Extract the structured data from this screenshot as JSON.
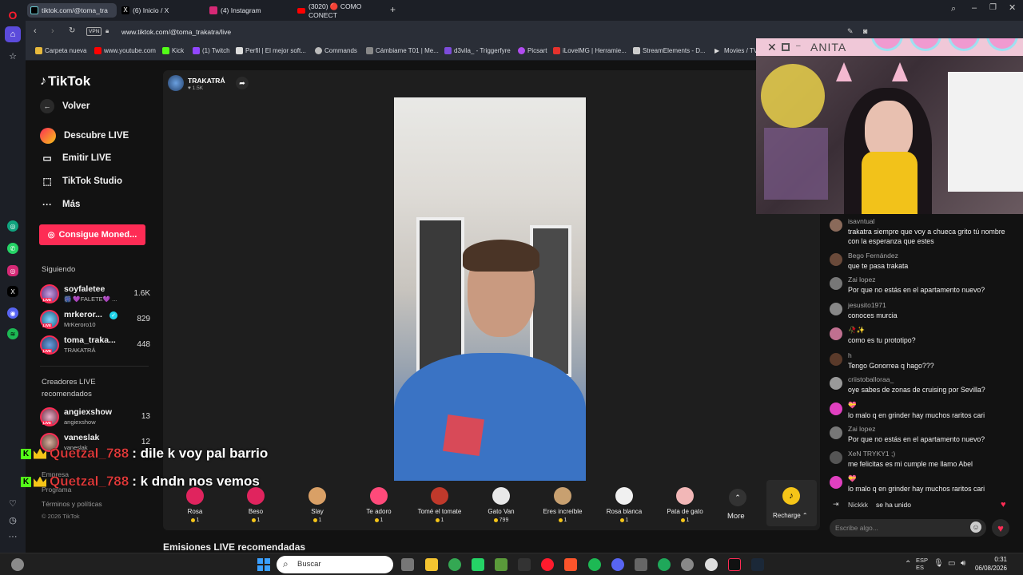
{
  "browser": {
    "tabs": [
      {
        "label": "tiktok.com/@toma_tra",
        "favicon": "tiktok-icon",
        "active": true
      },
      {
        "label": "(6) Inicio / X",
        "favicon": "x-icon"
      },
      {
        "label": "(4) Instagram",
        "favicon": "instagram-icon"
      },
      {
        "label": "(3020) 🔴 COMO CONECT",
        "favicon": "youtube-icon"
      }
    ],
    "new_tab": "+",
    "vpn_label": "VPN",
    "url": "www.tiktok.com/@toma_trakatra/live",
    "bookmarks": [
      "Carpeta nueva",
      "www.youtube.com",
      "Kick",
      "(1) Twitch",
      "Perfil | El mejor soft...",
      "Commands",
      "Cámbiame T01 | Me...",
      "d3vila_ - Triggerfyre",
      "Picsart",
      "iLovelMG | Herramie...",
      "StreamElements - D...",
      "Movies / TV"
    ]
  },
  "tiktok": {
    "logo": "TikTok",
    "back_label": "Volver",
    "nav": [
      {
        "label": "Descubre LIVE",
        "icon": "live-discover-icon"
      },
      {
        "label": "Emitir LIVE",
        "icon": "broadcast-icon"
      },
      {
        "label": "TikTok Studio",
        "icon": "studio-icon"
      },
      {
        "label": "Más",
        "icon": "more-icon"
      }
    ],
    "coins_button": "Consigue Moned...",
    "following_title": "Siguiendo",
    "live_badge": "LIVE",
    "following": [
      {
        "name": "soyfaletee",
        "sub": "🎆 💜FALETE💜 ...",
        "count": "1.6K"
      },
      {
        "name": "mrkeror...",
        "sub": "MrKeroro10",
        "count": "829",
        "verified": true
      },
      {
        "name": "toma_traka...",
        "sub": "TRAKATRÁ",
        "count": "448"
      }
    ],
    "creators_title": "Creadores LIVE recomendados",
    "creators": [
      {
        "name": "angiexshow",
        "sub": "angiexshow",
        "count": "13"
      },
      {
        "name": "vaneslak",
        "sub": "vaneslak",
        "count": "12"
      }
    ],
    "footer": {
      "empresa": "Empresa",
      "programa": "Programa",
      "terms": "Términos y políticas",
      "copyright": "© 2026 TikTok"
    },
    "streamer": {
      "name": "TRAKATRÁ",
      "likes": "1.5K"
    },
    "gifts": [
      {
        "name": "Rosa",
        "price": "1",
        "color": "#e0245e"
      },
      {
        "name": "Beso",
        "price": "1",
        "color": "#e0245e"
      },
      {
        "name": "Slay",
        "price": "1",
        "color": "#d9a066"
      },
      {
        "name": "Te adoro",
        "price": "1",
        "color": "#ff4a7a"
      },
      {
        "name": "Tomé el tomate",
        "price": "1",
        "color": "#c0392b"
      },
      {
        "name": "Gato Van",
        "price": "799",
        "color": "#e8e8e8"
      },
      {
        "name": "Eres increíble",
        "price": "1",
        "color": "#c8a070"
      },
      {
        "name": "Rosa blanca",
        "price": "1",
        "color": "#f0f0f0"
      },
      {
        "name": "Pata de gato",
        "price": "1",
        "color": "#f2b7b7"
      }
    ],
    "more_label": "More",
    "recharge_label": "Recharge",
    "recommended_title": "Emisiones LIVE recomendadas",
    "chat": [
      {
        "user": "isavntual",
        "text": "trakatra siempre que voy a chueca grito tú nombre con la esperanza que estes"
      },
      {
        "user": "Bego Fernández",
        "text": "que te pasa trakata"
      },
      {
        "user": "Zai lopez",
        "text": "Por que no estás en el apartamento nuevo?"
      },
      {
        "user": "jesusito1971",
        "text": "conoces murcia"
      },
      {
        "user": "🥀✨",
        "text": "como es tu prototipo?"
      },
      {
        "user": "h",
        "text": "Tengo Gonorrea q hago???"
      },
      {
        "user": "criistoballoraa_",
        "text": "oye sabes de zonas de cruising por Sevilla?"
      },
      {
        "user": "💝",
        "text": "lo malo q en grinder hay muchos raritos cari"
      },
      {
        "user": "Zai lopez",
        "text": "Por que no estás en el apartamento nuevo?"
      },
      {
        "user": "XeN TRYKY1 ;)",
        "text": "me felicitas es mi cumple me llamo Abel"
      },
      {
        "user": "💝",
        "text": "lo malo q en grinder hay muchos raritos cari"
      }
    ],
    "join_user": "Nickkk",
    "join_text": "se ha unido",
    "chat_placeholder": "Escribe algo..."
  },
  "webcam": {
    "label": "ANITA"
  },
  "overlay": [
    {
      "user": "Quetzal_788",
      "msg": ": dile k voy pal barrio"
    },
    {
      "user": "Quetzal_788",
      "msg": ": k dndn nos vemos"
    }
  ],
  "taskbar": {
    "search_placeholder": "Buscar",
    "lang": "ESP\nES",
    "time": "0:31",
    "date": "06/08/2026"
  },
  "colors": {
    "accent": "#fe2c55",
    "kick": "#53fc18"
  }
}
